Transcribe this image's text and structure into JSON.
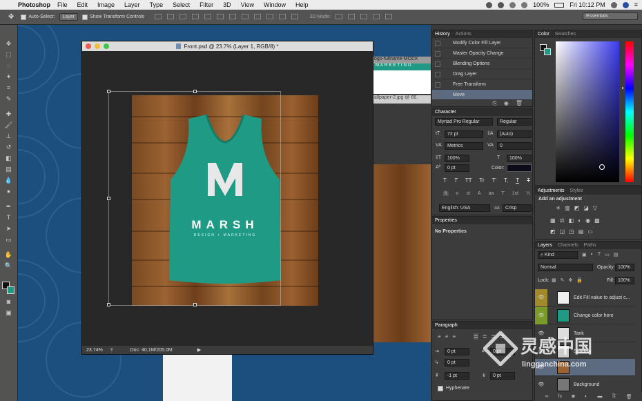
{
  "menubar": {
    "app": "Photoshop",
    "items": [
      "File",
      "Edit",
      "Image",
      "Layer",
      "Type",
      "Select",
      "Filter",
      "3D",
      "View",
      "Window",
      "Help"
    ],
    "battery": "100%",
    "clock": "Fri 10:12 PM"
  },
  "options": {
    "auto_select_label": "Auto-Select:",
    "auto_select_value": "Layer",
    "transform_label": "Show Transform Controls",
    "mode_3d": "3D Mode:",
    "workspace": "Essentials"
  },
  "document": {
    "title": "Front.psd @ 23.7% (Layer 1, RGB/8) *",
    "zoom": "23.74%",
    "doc_info": "Doc: 40.1M/205.0M",
    "mockup_brand": "MARSH",
    "mockup_tagline": "DESIGN + MARKETING",
    "mockup_letter": "M"
  },
  "background_docs": {
    "tab1": "ogo-fullname-MOCK",
    "tab1_sub": "MARKETING",
    "tab2": "allpaper-2.jpg @ 66."
  },
  "history": {
    "tabs": [
      "History",
      "Actions"
    ],
    "items": [
      "Modify Color Fill Layer",
      "Master Opacity Change",
      "Blending Options",
      "Drag Layer",
      "Free Transform",
      "Move"
    ]
  },
  "character": {
    "title": "Character",
    "font": "Myriad Pro Regular",
    "style": "Regular",
    "size": "72 pt",
    "leading": "(Auto)",
    "kerning": "Metrics",
    "tracking": "0",
    "vscale": "100%",
    "hscale": "100%",
    "baseline": "0 pt",
    "color_label": "Color:",
    "type_buttons": [
      "T",
      "T",
      "TT",
      "Tr",
      "T'",
      "T,",
      "T",
      "T"
    ],
    "language": "English: USA",
    "aa_label": "aa",
    "antialias": "Crisp"
  },
  "properties": {
    "title": "Properties",
    "empty": "No Properties"
  },
  "paragraph": {
    "title": "Paragraph",
    "indent_left": "0 pt",
    "indent_right": "0 pt",
    "indent_first": "0 pt",
    "space_before": "-1 pt",
    "space_after": "0 pt",
    "hyphenate": "Hyphenate"
  },
  "color": {
    "tabs": [
      "Color",
      "Swatches"
    ]
  },
  "adjustments": {
    "tabs": [
      "Adjustments",
      "Styles"
    ],
    "add": "Add an adjustment"
  },
  "layers": {
    "tabs": [
      "Layers",
      "Channels",
      "Paths"
    ],
    "filter": "Kind",
    "blend": "Normal",
    "opacity_label": "Opacity:",
    "opacity": "100%",
    "lock_label": "Lock:",
    "fill_label": "Fill:",
    "fill": "100%",
    "rows": [
      "Edit Fill value to adjust c...",
      "Change  color here",
      "Tank",
      "Shadow",
      "",
      "Background"
    ]
  },
  "watermark": {
    "cn": "灵感中国",
    "url": "lingganchina.com"
  },
  "colors": {
    "teal": "#1f9a85",
    "accent_blue": "#5c6b80"
  }
}
